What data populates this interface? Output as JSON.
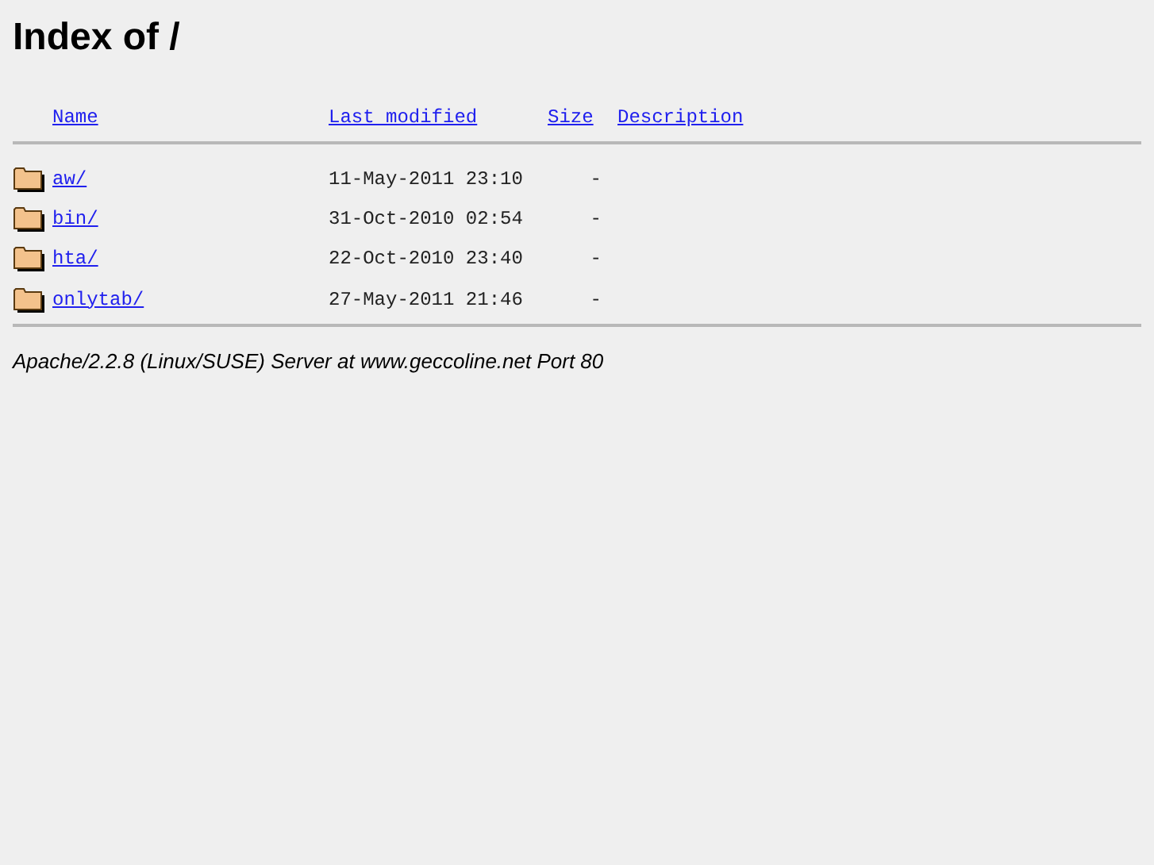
{
  "title": "Index of /",
  "columns": [
    "Name",
    "Last modified",
    "Size",
    "Description"
  ],
  "rows": [
    {
      "name": "aw/",
      "modified": "11-May-2011 23:10",
      "size": "-"
    },
    {
      "name": "bin/",
      "modified": "31-Oct-2010 02:54",
      "size": "-"
    },
    {
      "name": "hta/",
      "modified": "22-Oct-2010 23:40",
      "size": "-"
    },
    {
      "name": "onlytab/",
      "modified": "27-May-2011 21:46",
      "size": "-"
    }
  ],
  "address": "Apache/2.2.8 (Linux/SUSE) Server at www.geccoline.net Port 80"
}
